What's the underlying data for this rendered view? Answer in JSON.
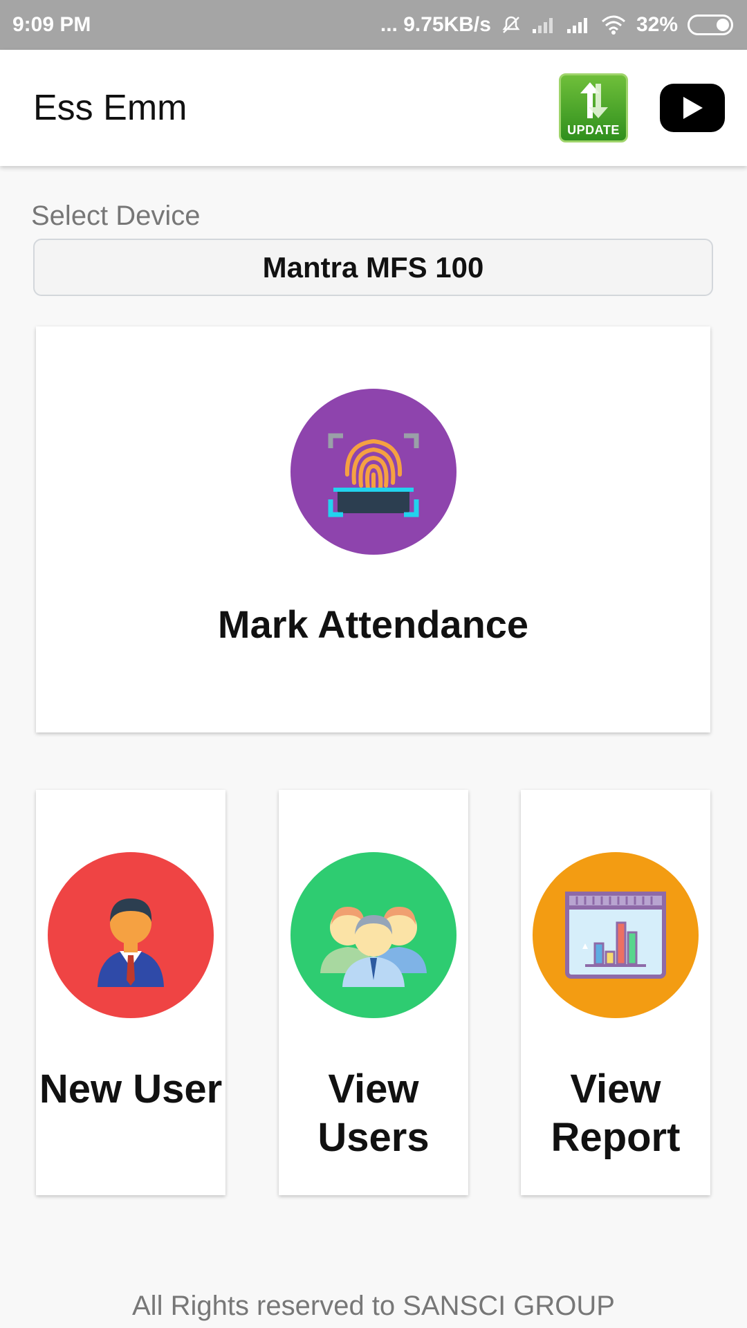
{
  "status_bar": {
    "time": "9:09 PM",
    "network_speed": "... 9.75KB/s",
    "battery": "32%"
  },
  "app_bar": {
    "title": "Ess Emm",
    "update_label": "UPDATE"
  },
  "device": {
    "label": "Select Device",
    "selected": "Mantra MFS 100"
  },
  "actions": {
    "mark_attendance": "Mark Attendance",
    "new_user": "New User",
    "view_users": "View\nUsers",
    "view_report": "View\nReport"
  },
  "colors": {
    "mark_attendance": "#8e44ad",
    "new_user": "#ef4444",
    "view_users": "#2ecc71",
    "view_report": "#f39c12"
  },
  "footer": {
    "text": "All Rights reserved to SANSCI GROUP"
  }
}
